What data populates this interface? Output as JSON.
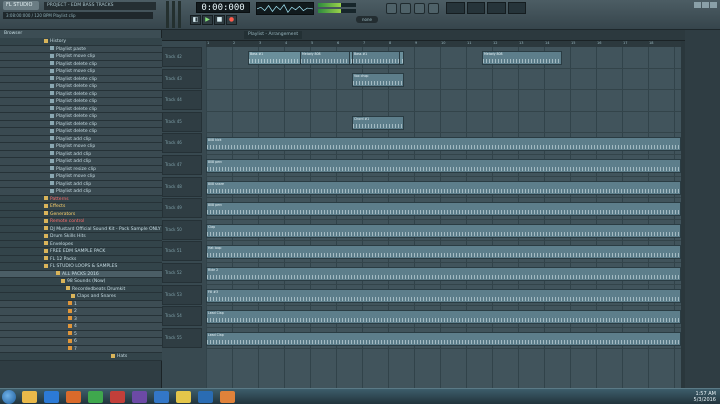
{
  "app": {
    "logo": "FL STUDIO",
    "project_title": "PROJECT - EDM BASS TRACKS",
    "hint": "3:08:00:000 / 120 BPM Playlist clip",
    "tempo": "0:00:000",
    "hint2": "none",
    "playlist_title": "Playlist - Arrangement"
  },
  "browser": {
    "header": "Browser",
    "items": [
      {
        "label": "History",
        "kind": "folder"
      },
      {
        "label": "Playlist paste",
        "kind": "sub"
      },
      {
        "label": "Playlist move clip",
        "kind": "sub"
      },
      {
        "label": "Playlist delete clip",
        "kind": "sub"
      },
      {
        "label": "Playlist move clip",
        "kind": "sub"
      },
      {
        "label": "Playlist delete clip",
        "kind": "sub"
      },
      {
        "label": "Playlist delete clip",
        "kind": "sub"
      },
      {
        "label": "Playlist delete clip",
        "kind": "sub"
      },
      {
        "label": "Playlist delete clip",
        "kind": "sub"
      },
      {
        "label": "Playlist delete clip",
        "kind": "sub"
      },
      {
        "label": "Playlist delete clip",
        "kind": "sub"
      },
      {
        "label": "Playlist delete clip",
        "kind": "sub"
      },
      {
        "label": "Playlist delete clip",
        "kind": "sub"
      },
      {
        "label": "Playlist add clip",
        "kind": "sub"
      },
      {
        "label": "Playlist move clip",
        "kind": "sub"
      },
      {
        "label": "Playlist add clip",
        "kind": "sub"
      },
      {
        "label": "Playlist add clip",
        "kind": "sub"
      },
      {
        "label": "Playlist resize clip",
        "kind": "sub"
      },
      {
        "label": "Playlist move clip",
        "kind": "sub"
      },
      {
        "label": "Playlist add clip",
        "kind": "sub"
      },
      {
        "label": "Playlist add clip",
        "kind": "sub"
      },
      {
        "label": "Patterns",
        "kind": "folder accent"
      },
      {
        "label": "Effects",
        "kind": "folder active"
      },
      {
        "label": "Generators",
        "kind": "folder active"
      },
      {
        "label": "Remote control",
        "kind": "folder accent"
      },
      {
        "label": "DJ Mustard Official Sound Kit - Pack Sample ONLY",
        "kind": "folder"
      },
      {
        "label": "Drum Skills Hits",
        "kind": "folder"
      },
      {
        "label": "Envelopes",
        "kind": "folder"
      },
      {
        "label": "FREE EDM SAMPLE PACK",
        "kind": "folder"
      },
      {
        "label": "FL 12 Packs",
        "kind": "folder"
      },
      {
        "label": "FL STUDIO LOOPS & SAMPLES",
        "kind": "folder"
      },
      {
        "label": "ALL PACKS 2016",
        "kind": "folder bright"
      },
      {
        "label": "98 Sounds (Now)",
        "kind": "folder"
      },
      {
        "label": "Recordedbeats Drumkit",
        "kind": "folder"
      },
      {
        "label": "Claps and Snares",
        "kind": "folder"
      },
      {
        "label": "1",
        "kind": "num"
      },
      {
        "label": "2",
        "kind": "num"
      },
      {
        "label": "3",
        "kind": "num"
      },
      {
        "label": "4",
        "kind": "num"
      },
      {
        "label": "5",
        "kind": "num"
      },
      {
        "label": "6",
        "kind": "num"
      },
      {
        "label": "7",
        "kind": "num"
      },
      {
        "label": "Hats",
        "kind": "folder"
      }
    ]
  },
  "ruler": [
    "1",
    "2",
    "3",
    "4",
    "5",
    "6",
    "7",
    "8",
    "9",
    "10",
    "11",
    "12",
    "13",
    "14",
    "15",
    "16",
    "17",
    "18"
  ],
  "tracks": [
    {
      "label": "Track 42"
    },
    {
      "label": "Track 43"
    },
    {
      "label": "Track 44"
    },
    {
      "label": "Track 45"
    },
    {
      "label": "Track 46"
    },
    {
      "label": "Track 47"
    },
    {
      "label": "Track 48"
    },
    {
      "label": "Track 49"
    },
    {
      "label": "Track 50"
    },
    {
      "label": "Track 51"
    },
    {
      "label": "Track 52"
    },
    {
      "label": "Track 53"
    },
    {
      "label": "Track 54"
    },
    {
      "label": "Track 55"
    }
  ],
  "clips": {
    "bass": "Bass #1",
    "melody": "Melody 808",
    "vocal": "Vox chop",
    "chord": "Chord #1",
    "kick": "808 kick",
    "perc": "808 perc",
    "snare": "808 snare",
    "clap": "Clap",
    "hat": "Hat loop",
    "ride": "Ride 2",
    "fill": "Fill #3",
    "lead": "Lead Clap"
  },
  "taskbar": {
    "time": "1:57 AM",
    "date": "5/3/2016"
  }
}
